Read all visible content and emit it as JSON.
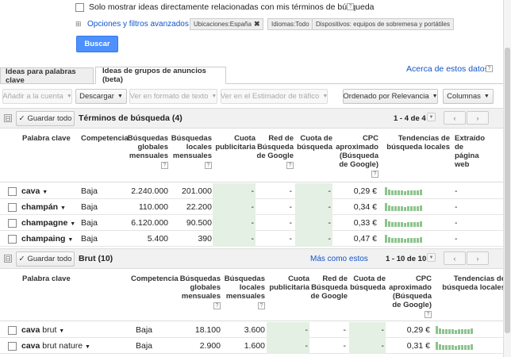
{
  "filters": {
    "only_related_label": "Solo mostrar ideas directamente relacionadas con mis términos de búsqueda",
    "help": "?",
    "advanced_toggle": "⊞",
    "advanced_label": "Opciones y filtros avanzados",
    "tags": [
      "Ubicaciones:España",
      "Idiomas:Todo",
      "Dispositivos: equipos de sobremesa y portátiles"
    ],
    "search_button": "Buscar"
  },
  "about_link": "Acerca de estos datos",
  "tabs": [
    "Ideas para palabras clave",
    "Ideas de grupos de anuncios (beta)"
  ],
  "toolbar": {
    "add_to_account": "Añadir a la cuenta",
    "download": "Descargar",
    "text_format": "Ver en formato de texto",
    "traffic_estimator": "Ver en el Estimador de tráfico",
    "sort": "Ordenado por Relevancia",
    "columns": "Columnas"
  },
  "group1": {
    "collapse": "⊟",
    "save_all": "Guardar todo",
    "title": "Términos de búsqueda (4)",
    "pager": "1 - 4 de 4",
    "headers": {
      "keyword": "Palabra clave",
      "competition": "Competencia",
      "global": [
        "Búsquedas",
        "globales",
        "mensuales"
      ],
      "local": [
        "Búsquedas",
        "locales",
        "mensuales"
      ],
      "share": [
        "Cuota",
        "publicitaria"
      ],
      "network": [
        "Red de",
        "Búsqueda",
        "de Google"
      ],
      "search_share": [
        "Cuota de",
        "búsqueda"
      ],
      "cpc": [
        "CPC",
        "aproximado",
        "(Búsqueda",
        "de Google)"
      ],
      "trends": [
        "Tendencias de",
        "búsqueda locales"
      ],
      "extracted": [
        "Extraído",
        "de",
        "página",
        "web"
      ]
    },
    "rows": [
      {
        "keyword": "cava",
        "competition": "Baja",
        "global": "2.240.000",
        "local": "201.000",
        "share": "-",
        "network": "-",
        "search_share": "-",
        "cpc": "0,29 €",
        "extracted": "-"
      },
      {
        "keyword": "champán",
        "competition": "Baja",
        "global": "110.000",
        "local": "22.200",
        "share": "-",
        "network": "-",
        "search_share": "-",
        "cpc": "0,34 €",
        "extracted": "-"
      },
      {
        "keyword": "champagne",
        "competition": "Baja",
        "global": "6.120.000",
        "local": "90.500",
        "share": "-",
        "network": "-",
        "search_share": "-",
        "cpc": "0,33 €",
        "extracted": "-"
      },
      {
        "keyword": "champaing",
        "competition": "Baja",
        "global": "5.400",
        "local": "390",
        "share": "-",
        "network": "-",
        "search_share": "-",
        "cpc": "0,47 €",
        "extracted": "-"
      }
    ]
  },
  "group2": {
    "collapse": "⊟",
    "save_all": "Guardar todo",
    "title": "Brut (10)",
    "more_like": "Más como estos",
    "pager": "1 - 10 de 10",
    "headers": {
      "keyword": "Palabra clave",
      "competition": "Competencia",
      "global": [
        "Búsquedas",
        "globales",
        "mensuales"
      ],
      "local": [
        "Búsquedas",
        "locales",
        "mensuales"
      ],
      "share": [
        "Cuota",
        "publicitaria"
      ],
      "network": [
        "Red de",
        "Búsqueda",
        "de Google"
      ],
      "search_share": [
        "Cuota de",
        "búsqueda"
      ],
      "cpc": [
        "CPC",
        "aproximado",
        "(Búsqueda",
        "de Google)"
      ],
      "trends": [
        "Tendencias de",
        "búsqueda locales"
      ]
    },
    "rows": [
      {
        "kw1": "cava",
        "kw2": "brut",
        "competition": "Baja",
        "global": "18.100",
        "local": "3.600",
        "share": "-",
        "network": "-",
        "search_share": "-",
        "cpc": "0,29 €"
      },
      {
        "kw1": "cava",
        "kw2": "brut nature",
        "competition": "Baja",
        "global": "2.900",
        "local": "1.600",
        "share": "-",
        "network": "-",
        "search_share": "-",
        "cpc": "0,31 €"
      }
    ]
  },
  "icons": {
    "checkmark": "✓",
    "dropdown": "▼",
    "prev": "‹",
    "next": "›",
    "close": "✖"
  },
  "colors": {
    "accent": "#4d90fe",
    "link": "#1155cc",
    "trend_bar": "#8ec48e",
    "highlight_column": "#e3f0e3"
  }
}
